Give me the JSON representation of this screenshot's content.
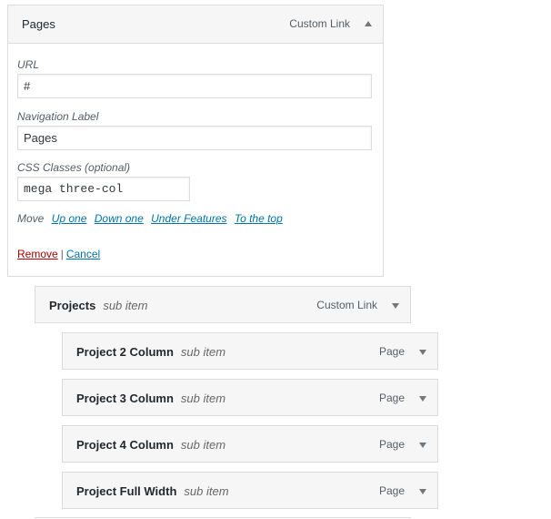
{
  "expanded_item": {
    "title": "Pages",
    "type": "Custom Link",
    "fields": {
      "url_label": "URL",
      "url_value": "#",
      "nav_label": "Navigation Label",
      "nav_value": "Pages",
      "css_label": "CSS Classes (optional)",
      "css_value": "mega three-col"
    },
    "move": {
      "label": "Move",
      "links": [
        "Up one",
        "Down one",
        "Under Features",
        "To the top"
      ]
    },
    "actions": {
      "remove": "Remove",
      "separator": "|",
      "cancel": "Cancel"
    },
    "toggle_icon": "arrow-up-icon"
  },
  "items": [
    {
      "title": "Projects",
      "sub": "sub item",
      "type": "Custom Link",
      "toggle_icon": "arrow-down-icon"
    },
    {
      "title": "Project 2 Column",
      "sub": "sub item",
      "type": "Page",
      "toggle_icon": "arrow-down-icon"
    },
    {
      "title": "Project 3 Column",
      "sub": "sub item",
      "type": "Page",
      "toggle_icon": "arrow-down-icon"
    },
    {
      "title": "Project 4 Column",
      "sub": "sub item",
      "type": "Page",
      "toggle_icon": "arrow-down-icon"
    },
    {
      "title": "Project Full Width",
      "sub": "sub item",
      "type": "Page",
      "toggle_icon": "arrow-down-icon"
    }
  ],
  "colors": {
    "link": "#0073aa",
    "remove": "#aa0000",
    "bar_bg": "#f6f6f6",
    "border": "#dcdcde"
  }
}
